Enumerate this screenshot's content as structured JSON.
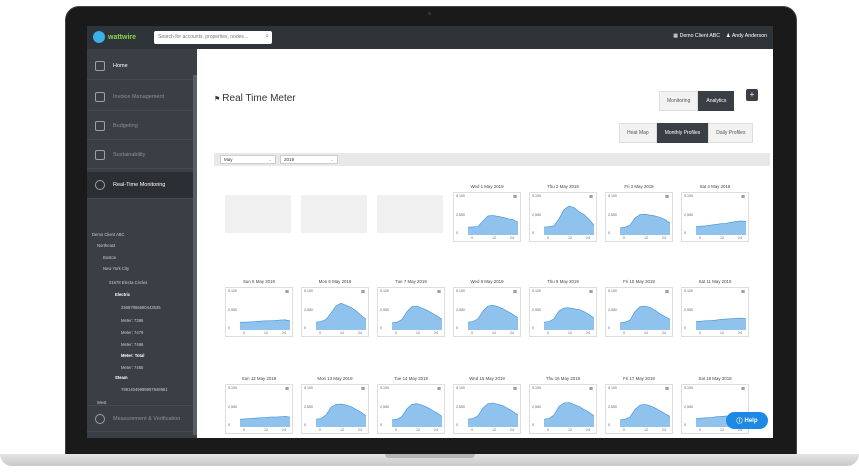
{
  "app": {
    "logo_text": "wattwire",
    "search_placeholder": "Search for accounts, properties, nodes..."
  },
  "topbar": {
    "client": "Demo Client ABC",
    "user": "Andy Anderson"
  },
  "sidebar": {
    "items": [
      {
        "label": "Home"
      },
      {
        "label": "Invoice Management"
      },
      {
        "label": "Budgeting"
      },
      {
        "label": "Sustainability"
      },
      {
        "label": "Real-Time Monitoring"
      },
      {
        "label": "Measurement & Verification"
      }
    ],
    "tree": [
      "Demo Client ABC",
      "Northeast",
      "Boston",
      "New York City",
      "01678 Electa Circles",
      "Electric",
      "25687956680443635",
      "Meter: 7386",
      "Meter: 7479",
      "Meter: 7466",
      "Meter: Total",
      "Meter: 7465",
      "Steam",
      "79914049999957948961",
      "West"
    ]
  },
  "page": {
    "title": "Real Time Meter",
    "mode_tabs": [
      "Monitoring",
      "Analytics"
    ],
    "mode_selected": "Analytics",
    "profile_tabs": [
      "Heat Map",
      "Monthly Profiles",
      "Daily Profiles"
    ],
    "profile_selected": "Monthly Profiles",
    "filters": {
      "month": "May",
      "year": "2019"
    }
  },
  "chart_data": {
    "type": "area",
    "y_ticks": [
      "5,100",
      "2,550",
      "0"
    ],
    "x_ticks": [
      "0",
      "12",
      "24"
    ],
    "ylim": [
      0,
      5100
    ],
    "days": [
      {
        "title": "Wed 1 May 2019",
        "values": [
          1100,
          1150,
          1200,
          2000,
          2700,
          2750,
          2650,
          2500,
          2300,
          2200,
          1800
        ]
      },
      {
        "title": "Thu 2 May 2019",
        "values": [
          1100,
          1200,
          1300,
          2300,
          3600,
          4100,
          3900,
          3300,
          2900,
          2200,
          1400
        ]
      },
      {
        "title": "Fri 3 May 2019",
        "values": [
          1000,
          1100,
          1400,
          2400,
          2900,
          2950,
          2800,
          2700,
          2500,
          2200,
          1700
        ]
      },
      {
        "title": "Sat 4 May 2019",
        "values": [
          1200,
          1250,
          1300,
          1400,
          1500,
          1600,
          1650,
          1800,
          1900,
          2000,
          1900
        ]
      },
      {
        "title": "Sun 5 May 2019",
        "values": [
          1100,
          1100,
          1150,
          1200,
          1250,
          1300,
          1300,
          1350,
          1400,
          1450,
          1300
        ]
      },
      {
        "title": "Mon 6 May 2019",
        "values": [
          1100,
          1200,
          1500,
          2400,
          3400,
          3800,
          3500,
          3200,
          2700,
          2100,
          1500
        ]
      },
      {
        "title": "Tue 7 May 2019",
        "values": [
          1000,
          1100,
          1500,
          2600,
          3300,
          3400,
          3100,
          2800,
          2400,
          2000,
          1500
        ]
      },
      {
        "title": "Wed 8 May 2019",
        "values": [
          1100,
          1200,
          1600,
          2700,
          3400,
          3500,
          3300,
          3000,
          2600,
          2200,
          1700
        ]
      },
      {
        "title": "Thu 9 May 2019",
        "values": [
          1100,
          1200,
          1600,
          2700,
          3100,
          3150,
          3000,
          2900,
          2600,
          2200,
          1700
        ]
      },
      {
        "title": "Fri 10 May 2019",
        "values": [
          1000,
          1100,
          1400,
          2600,
          3300,
          3400,
          3200,
          2800,
          2300,
          1900,
          1500
        ]
      },
      {
        "title": "Sat 11 May 2019",
        "values": [
          1200,
          1250,
          1300,
          1350,
          1400,
          1500,
          1550,
          1600,
          1650,
          1700,
          1600
        ]
      },
      {
        "title": "Sun 12 May 2019",
        "values": [
          1100,
          1150,
          1200,
          1250,
          1300,
          1350,
          1400,
          1400,
          1450,
          1500,
          1400
        ]
      },
      {
        "title": "Mon 13 May 2019",
        "values": [
          1100,
          1200,
          1700,
          2800,
          3200,
          3250,
          3100,
          2900,
          2500,
          2100,
          1600
        ]
      },
      {
        "title": "Tue 14 May 2019",
        "values": [
          1000,
          1100,
          1500,
          2600,
          3200,
          3300,
          3100,
          2800,
          2400,
          2000,
          1500
        ]
      },
      {
        "title": "Wed 15 May 2019",
        "values": [
          1100,
          1200,
          1600,
          2700,
          3300,
          3400,
          3200,
          3000,
          2600,
          2200,
          1700
        ]
      },
      {
        "title": "Thu 16 May 2019",
        "values": [
          1100,
          1200,
          1700,
          2900,
          3400,
          3450,
          3200,
          2900,
          2500,
          2100,
          1600
        ]
      },
      {
        "title": "Fri 17 May 2019",
        "values": [
          1000,
          1100,
          1400,
          2500,
          3100,
          3200,
          3000,
          2700,
          2300,
          1900,
          1500
        ]
      },
      {
        "title": "Sat 18 May 2019",
        "values": [
          1200,
          1250,
          1300,
          1350,
          1450,
          1500,
          1550,
          1600,
          1650,
          1700,
          1600
        ]
      }
    ],
    "fill_color": "#8fc3ee",
    "line_color": "#3d8fd6"
  },
  "help": {
    "label": "Help"
  }
}
